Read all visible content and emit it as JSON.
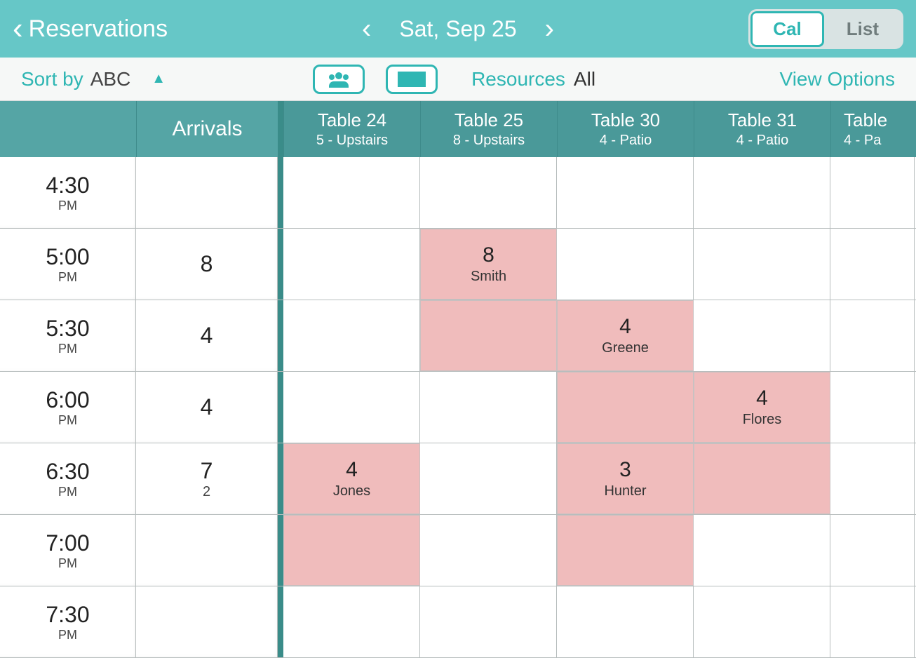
{
  "topbar": {
    "back_label": "Reservations",
    "date_label": "Sat, Sep 25",
    "toggle_cal": "Cal",
    "toggle_list": "List"
  },
  "toolbar": {
    "sort_label": "Sort by",
    "sort_value": "ABC",
    "resources_label": "Resources",
    "resources_value": "All",
    "view_options": "View Options"
  },
  "columns": {
    "arrivals": "Arrivals",
    "tables": [
      {
        "name": "Table 24",
        "sub": "5 - Upstairs"
      },
      {
        "name": "Table 25",
        "sub": "8 - Upstairs"
      },
      {
        "name": "Table 30",
        "sub": "4 - Patio"
      },
      {
        "name": "Table 31",
        "sub": "4 - Patio"
      },
      {
        "name": "Table",
        "sub": "4 - Pa"
      }
    ]
  },
  "rows": [
    {
      "time": "4:30",
      "ampm": "PM",
      "arrivals": "",
      "arrivals_sub": "",
      "cells": [
        {
          "booked": false
        },
        {
          "booked": false
        },
        {
          "booked": false
        },
        {
          "booked": false
        },
        {
          "booked": false
        }
      ]
    },
    {
      "time": "5:00",
      "ampm": "PM",
      "arrivals": "8",
      "arrivals_sub": "",
      "cells": [
        {
          "booked": false
        },
        {
          "booked": true,
          "count": "8",
          "name": "Smith"
        },
        {
          "booked": false
        },
        {
          "booked": false
        },
        {
          "booked": false
        }
      ]
    },
    {
      "time": "5:30",
      "ampm": "PM",
      "arrivals": "4",
      "arrivals_sub": "",
      "cells": [
        {
          "booked": false
        },
        {
          "booked": true
        },
        {
          "booked": true,
          "count": "4",
          "name": "Greene"
        },
        {
          "booked": false
        },
        {
          "booked": false
        }
      ]
    },
    {
      "time": "6:00",
      "ampm": "PM",
      "arrivals": "4",
      "arrivals_sub": "",
      "cells": [
        {
          "booked": false
        },
        {
          "booked": false
        },
        {
          "booked": true
        },
        {
          "booked": true,
          "count": "4",
          "name": "Flores"
        },
        {
          "booked": false
        }
      ]
    },
    {
      "time": "6:30",
      "ampm": "PM",
      "arrivals": "7",
      "arrivals_sub": "2",
      "cells": [
        {
          "booked": true,
          "count": "4",
          "name": "Jones"
        },
        {
          "booked": false
        },
        {
          "booked": true,
          "count": "3",
          "name": "Hunter"
        },
        {
          "booked": true
        },
        {
          "booked": false
        }
      ]
    },
    {
      "time": "7:00",
      "ampm": "PM",
      "arrivals": "",
      "arrivals_sub": "",
      "cells": [
        {
          "booked": true
        },
        {
          "booked": false
        },
        {
          "booked": true
        },
        {
          "booked": false
        },
        {
          "booked": false
        }
      ]
    },
    {
      "time": "7:30",
      "ampm": "PM",
      "arrivals": "",
      "arrivals_sub": "",
      "cells": [
        {
          "booked": false
        },
        {
          "booked": false
        },
        {
          "booked": false
        },
        {
          "booked": false
        },
        {
          "booked": false
        }
      ]
    }
  ]
}
